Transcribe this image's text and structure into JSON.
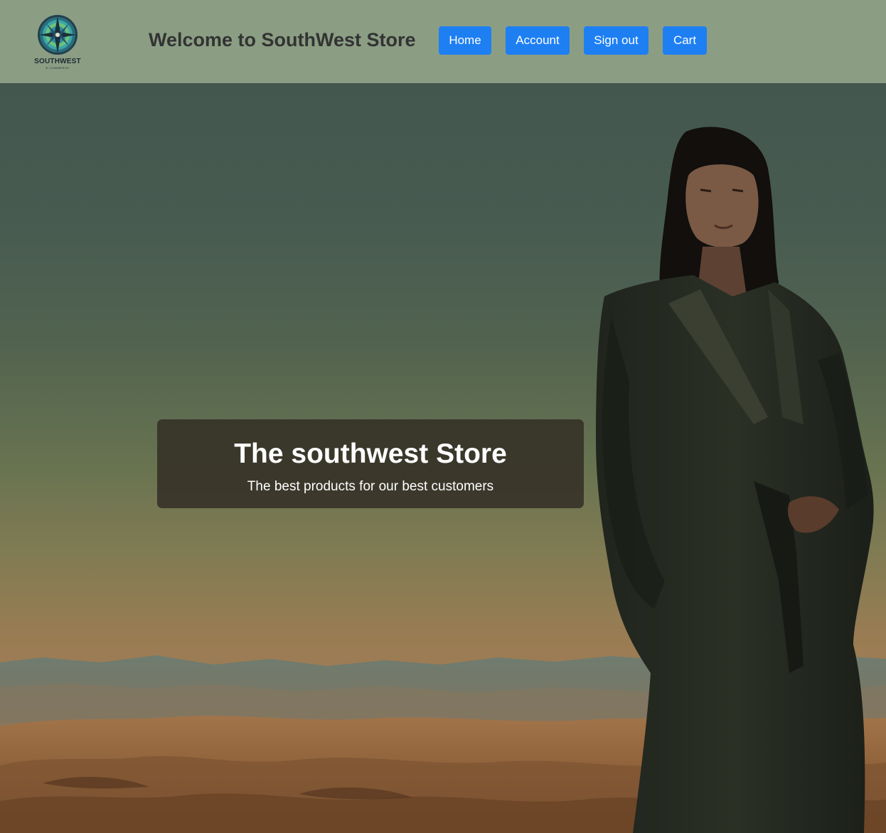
{
  "logo": {
    "name": "SOUTHWEST",
    "tagline": "E-COMMERCE"
  },
  "header": {
    "title": "Welcome to SouthWest Store"
  },
  "nav": {
    "home": "Home",
    "account": "Account",
    "sign_out": "Sign out",
    "cart": "Cart"
  },
  "hero": {
    "title": "The southwest Store",
    "subtitle": "The best products for our best customers"
  },
  "colors": {
    "header_bg": "#8b9e84",
    "button_bg": "#1e7ff3",
    "title_text": "#333333",
    "caption_bg": "#343026"
  }
}
